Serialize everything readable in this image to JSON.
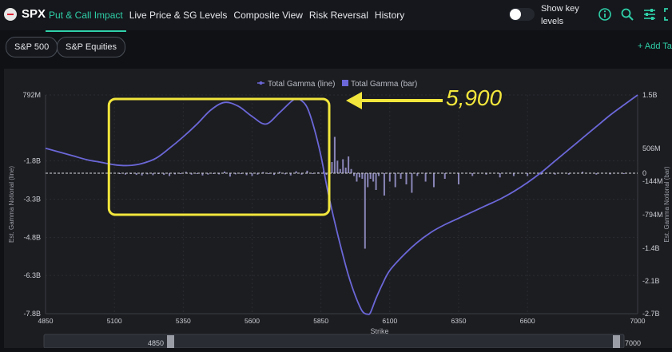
{
  "header": {
    "ticker": "SPX",
    "tabs": [
      {
        "label": "Put & Call Impact",
        "active": true
      },
      {
        "label": "Live Price & SG Levels",
        "active": false
      },
      {
        "label": "Composite View",
        "active": false
      },
      {
        "label": "Risk Reversal",
        "active": false
      },
      {
        "label": "History",
        "active": false
      }
    ],
    "show_key_levels_label": "Show key levels",
    "show_key_levels_on": false,
    "icons": [
      "info-icon",
      "search-icon",
      "settings-sliders-icon",
      "expand-icon"
    ]
  },
  "subbar": {
    "pills": [
      "S&P 500",
      "S&P Equities"
    ],
    "add_tab_label": "+ Add Tab"
  },
  "colors": {
    "accent": "#2fd0a8",
    "series": "#6b67d8",
    "annotation": "#f2e63c",
    "background": "#1c1d21"
  },
  "chart_data": {
    "type": "line",
    "legend": [
      "Total Gamma (line)",
      "Total Gamma (bar)"
    ],
    "legend_position": "top-center",
    "xlabel": "Strike",
    "ylabel_left": "Est. Gamma Notional (line)",
    "ylabel_right": "Est. Gamma Notional (bar)",
    "x_range": [
      4850,
      7000
    ],
    "x_ticks": [
      "4850",
      "5100",
      "5350",
      "5600",
      "5850",
      "6100",
      "6350",
      "6600",
      "7000"
    ],
    "y_left_range": [
      -7.8,
      0.792
    ],
    "y_left_ticks": [
      "792M",
      "-1.8B",
      "-3.3B",
      "-4.8B",
      "-6.3B",
      "-7.8B"
    ],
    "y_right_range": [
      -2.7,
      1.5
    ],
    "y_right_ticks": [
      "1.5B",
      "506M",
      "0",
      "-144M",
      "-794M",
      "-1.4B",
      "-2.1B",
      "-2.7B"
    ],
    "series": [
      {
        "name": "Total Gamma (line)",
        "unit": "B",
        "x": [
          4850,
          4900,
          4950,
          5000,
          5050,
          5100,
          5150,
          5200,
          5250,
          5300,
          5350,
          5400,
          5450,
          5500,
          5550,
          5600,
          5650,
          5700,
          5750,
          5775,
          5800,
          5825,
          5850,
          5875,
          5900,
          5925,
          5950,
          5975,
          6000,
          6020,
          6030,
          6050,
          6075,
          6100,
          6150,
          6200,
          6250,
          6300,
          6350,
          6400,
          6450,
          6500,
          6550,
          6600,
          6650,
          6700,
          6750,
          6800,
          6850,
          6900,
          6950,
          7000
        ],
        "values": [
          -1.3,
          -1.45,
          -1.6,
          -1.75,
          -1.85,
          -1.95,
          -1.98,
          -1.9,
          -1.7,
          -1.3,
          -0.85,
          -0.35,
          0.2,
          0.5,
          0.35,
          -0.05,
          -0.35,
          0.1,
          0.6,
          0.6,
          0.3,
          -0.5,
          -1.6,
          -3.0,
          -4.2,
          -5.3,
          -6.3,
          -7.1,
          -7.7,
          -7.82,
          -7.75,
          -7.2,
          -6.6,
          -6.1,
          -5.5,
          -5.0,
          -4.6,
          -4.3,
          -4.05,
          -3.8,
          -3.55,
          -3.3,
          -3.0,
          -2.65,
          -2.25,
          -1.8,
          -1.35,
          -0.9,
          -0.45,
          0.0,
          0.4,
          0.792
        ]
      },
      {
        "name": "Total Gamma (bar)",
        "unit": "B",
        "x": [
          5120,
          5140,
          5160,
          5180,
          5200,
          5220,
          5240,
          5260,
          5280,
          5300,
          5320,
          5340,
          5360,
          5380,
          5400,
          5420,
          5440,
          5460,
          5480,
          5500,
          5520,
          5540,
          5560,
          5580,
          5600,
          5620,
          5640,
          5660,
          5680,
          5700,
          5720,
          5740,
          5760,
          5780,
          5800,
          5820,
          5840,
          5860,
          5870,
          5880,
          5890,
          5900,
          5910,
          5920,
          5930,
          5940,
          5950,
          5960,
          5970,
          5980,
          5990,
          6000,
          6010,
          6020,
          6030,
          6040,
          6050,
          6060,
          6080,
          6100,
          6120,
          6140,
          6160,
          6180,
          6200,
          6230,
          6260,
          6300,
          6350,
          6400,
          6450,
          6500,
          6550,
          6600,
          6650,
          6700,
          6750,
          6800,
          6850,
          6900,
          6950
        ],
        "values": [
          -0.02,
          -0.05,
          -0.03,
          -0.06,
          -0.08,
          -0.04,
          -0.07,
          -0.03,
          -0.06,
          -0.1,
          -0.04,
          -0.03,
          0.05,
          -0.05,
          -0.03,
          -0.08,
          -0.05,
          -0.02,
          -0.04,
          0.06,
          -0.12,
          -0.04,
          -0.03,
          -0.07,
          -0.1,
          -0.05,
          0.04,
          -0.03,
          -0.06,
          0.05,
          -0.04,
          -0.08,
          0.07,
          -0.05,
          0.09,
          -0.03,
          0.03,
          0.08,
          -0.06,
          0.12,
          0.4,
          1.3,
          0.45,
          0.15,
          0.5,
          0.2,
          0.6,
          0.15,
          -0.1,
          -0.3,
          -0.15,
          -0.2,
          -2.7,
          -0.5,
          -0.2,
          -0.3,
          -0.6,
          -0.1,
          -0.8,
          -0.3,
          -0.5,
          -0.2,
          -0.4,
          -0.7,
          -0.1,
          -0.3,
          -0.5,
          -0.2,
          -0.4,
          -0.1,
          -0.05,
          -0.15,
          -0.1,
          -0.1,
          -0.05,
          -0.05,
          -0.05,
          0.05,
          -0.05,
          -0.04,
          -0.03
        ]
      }
    ],
    "annotations": [
      {
        "text": "5,900",
        "type": "arrow-label",
        "target_x": 5900
      }
    ],
    "highlight_box": {
      "x_range": [
        5080,
        5880
      ]
    }
  },
  "range_slider": {
    "start_label": "4850",
    "end_label": "7000"
  }
}
